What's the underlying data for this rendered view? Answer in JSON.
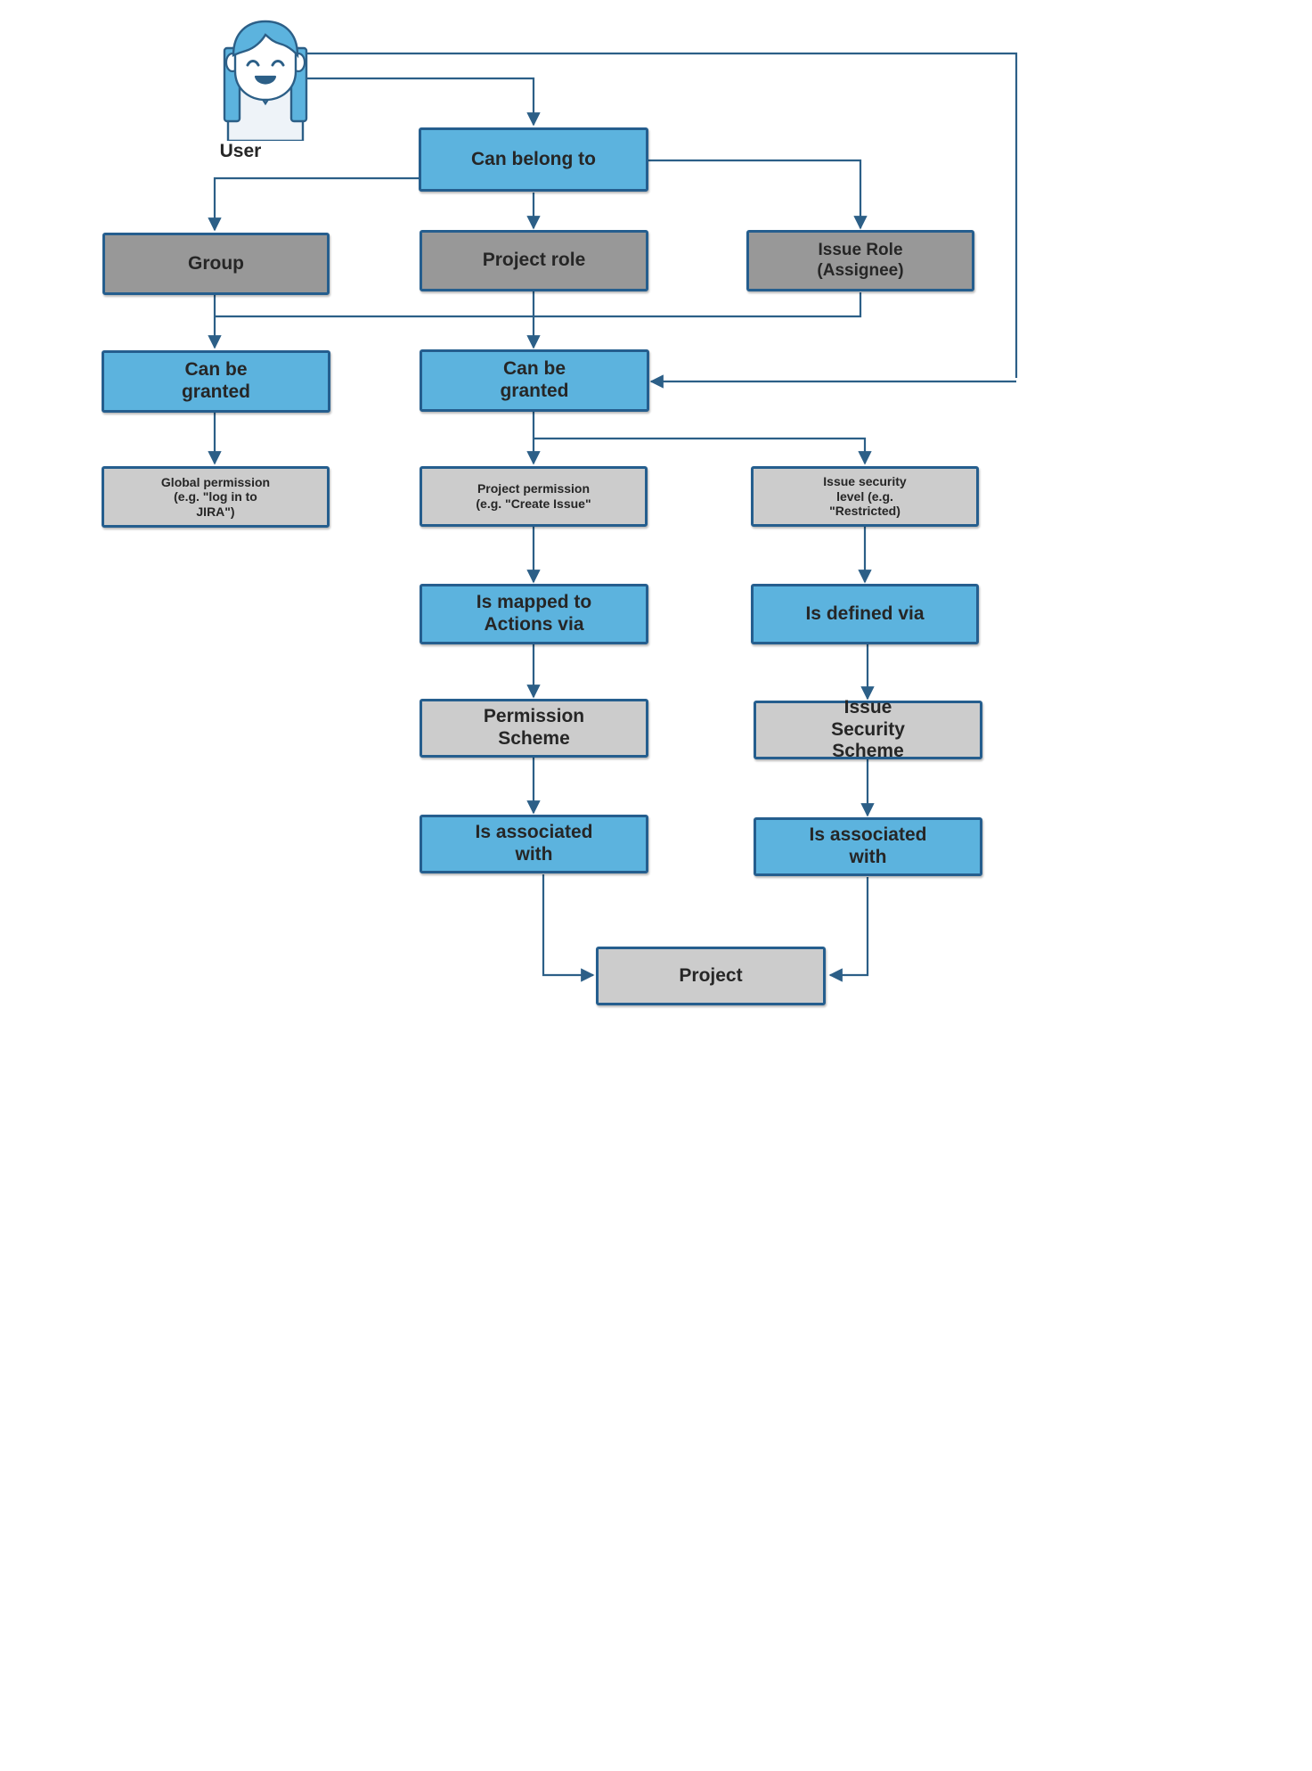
{
  "diagram": {
    "title": "JIRA permissions hierarchy",
    "colors": {
      "blue": "#5cb3de",
      "gray": "#989898",
      "light_gray": "#cccccc",
      "border": "#255e8e",
      "edge": "#2c5f87",
      "text": "#262626",
      "background": "#ffffff"
    },
    "actor": {
      "icon": "user-avatar-icon",
      "label": "User"
    },
    "nodes": [
      {
        "id": "can_belong_to",
        "label": "Can belong to",
        "type": "blue",
        "size": "lg"
      },
      {
        "id": "group",
        "label": "Group",
        "type": "gray",
        "size": "lg"
      },
      {
        "id": "project_role",
        "label": "Project role",
        "type": "gray",
        "size": "lg"
      },
      {
        "id": "issue_role",
        "label": "Issue Role\n(Assignee)",
        "type": "gray",
        "size": "md"
      },
      {
        "id": "can_be_granted_1",
        "label": "Can be\ngranted",
        "type": "blue",
        "size": "lg"
      },
      {
        "id": "can_be_granted_2",
        "label": "Can be\ngranted",
        "type": "blue",
        "size": "lg"
      },
      {
        "id": "global_permission",
        "label": "Global permission\n(e.g. \"log in to\nJIRA\")",
        "type": "lgray",
        "size": "sm"
      },
      {
        "id": "project_permission",
        "label": "Project permission\n(e.g. \"Create Issue\"",
        "type": "lgray",
        "size": "sm"
      },
      {
        "id": "issue_security",
        "label": "Issue security\nlevel (e.g.\n\"Restricted)",
        "type": "lgray",
        "size": "sm"
      },
      {
        "id": "is_mapped_to",
        "label": "Is mapped to\nActions via",
        "type": "blue",
        "size": "lg"
      },
      {
        "id": "is_defined_via",
        "label": "Is defined via",
        "type": "blue",
        "size": "lg"
      },
      {
        "id": "permission_scheme",
        "label": "Permission\nScheme",
        "type": "lgray",
        "size": "lg"
      },
      {
        "id": "issue_security_scheme",
        "label": "Issue\nSecurity\nScheme",
        "type": "lgray",
        "size": "lg"
      },
      {
        "id": "is_associated_1",
        "label": "Is associated\nwith",
        "type": "blue",
        "size": "lg"
      },
      {
        "id": "is_associated_2",
        "label": "Is associated\nwith",
        "type": "blue",
        "size": "lg"
      },
      {
        "id": "project",
        "label": "Project",
        "type": "lgray",
        "size": "lg"
      }
    ],
    "edges": [
      {
        "from": "user",
        "to": "can_belong_to"
      },
      {
        "from": "user",
        "to": "group"
      },
      {
        "from": "user",
        "to": "can_be_granted_2"
      },
      {
        "from": "can_belong_to",
        "to": "project_role"
      },
      {
        "from": "can_belong_to",
        "to": "issue_role"
      },
      {
        "from": "group",
        "to": "can_be_granted_1"
      },
      {
        "from": "project_role",
        "to": "can_be_granted_2"
      },
      {
        "from": "issue_role",
        "to": "can_be_granted_2"
      },
      {
        "from": "can_be_granted_1",
        "to": "global_permission"
      },
      {
        "from": "can_be_granted_2",
        "to": "project_permission"
      },
      {
        "from": "can_be_granted_2",
        "to": "issue_security"
      },
      {
        "from": "project_permission",
        "to": "is_mapped_to"
      },
      {
        "from": "issue_security",
        "to": "is_defined_via"
      },
      {
        "from": "is_mapped_to",
        "to": "permission_scheme"
      },
      {
        "from": "is_defined_via",
        "to": "issue_security_scheme"
      },
      {
        "from": "permission_scheme",
        "to": "is_associated_1"
      },
      {
        "from": "issue_security_scheme",
        "to": "is_associated_2"
      },
      {
        "from": "is_associated_1",
        "to": "project"
      },
      {
        "from": "is_associated_2",
        "to": "project"
      }
    ]
  }
}
